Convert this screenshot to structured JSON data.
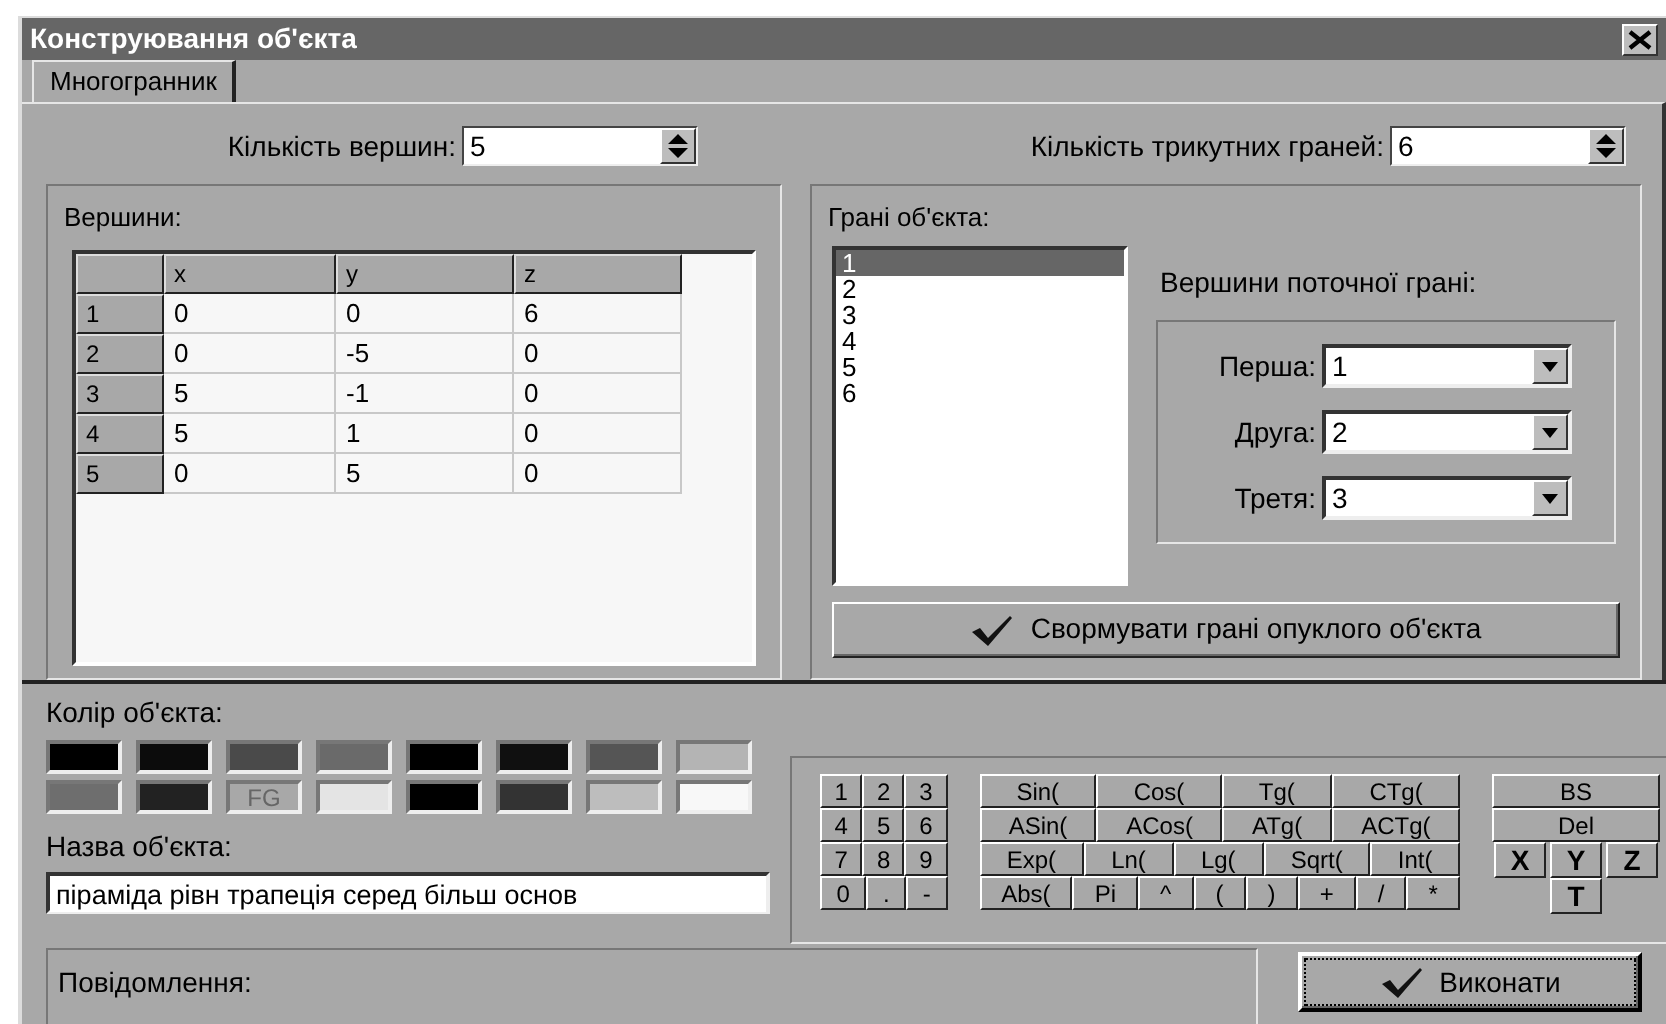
{
  "window": {
    "title": "Конструювання об'єкта"
  },
  "tabs": [
    {
      "label": "Многогранник",
      "selected": true
    }
  ],
  "vertex_count": {
    "label": "Кількість вершин:",
    "value": "5"
  },
  "face_count": {
    "label": "Кількість трикутних граней:",
    "value": "6"
  },
  "vertices": {
    "title": "Вершини:",
    "columns": [
      "x",
      "y",
      "z"
    ],
    "rows": [
      {
        "header": "1",
        "cells": [
          "0",
          "0",
          "6"
        ]
      },
      {
        "header": "2",
        "cells": [
          "0",
          "-5",
          "0"
        ]
      },
      {
        "header": "3",
        "cells": [
          "5",
          "-1",
          "0"
        ]
      },
      {
        "header": "4",
        "cells": [
          "5",
          "1",
          "0"
        ]
      },
      {
        "header": "5",
        "cells": [
          "0",
          "5",
          "0"
        ]
      }
    ]
  },
  "faces": {
    "title": "Грані об'єкта:",
    "items": [
      {
        "label": "1",
        "selected": true
      },
      {
        "label": "2",
        "selected": false
      },
      {
        "label": "3",
        "selected": false
      },
      {
        "label": "4",
        "selected": false
      },
      {
        "label": "5",
        "selected": false
      },
      {
        "label": "6",
        "selected": false
      }
    ]
  },
  "current_face": {
    "title": "Вершини поточної грані:",
    "fields": [
      {
        "label": "Перша:",
        "value": "1"
      },
      {
        "label": "Друга:",
        "value": "2"
      },
      {
        "label": "Третя:",
        "value": "3"
      }
    ]
  },
  "form_faces_button": "Свормувати грані опуклого об'єкта",
  "object_color": {
    "title": "Колір об'єкта:",
    "swatches": [
      {
        "color": "#000000"
      },
      {
        "color": "#0c0c0c"
      },
      {
        "color": "#4a4a4a"
      },
      {
        "color": "#6a6a6a"
      },
      {
        "color": "#000000"
      },
      {
        "color": "#101010"
      },
      {
        "color": "#555555"
      },
      {
        "color": "#b4b4b4"
      },
      {
        "color": "#6e6e6e"
      },
      {
        "color": "#222222"
      },
      {
        "color": "#a8a8a8",
        "label": "FG"
      },
      {
        "color": "#e4e4e4"
      },
      {
        "color": "#000000"
      },
      {
        "color": "#333333"
      },
      {
        "color": "#bdbdbd"
      },
      {
        "color": "#f8f8f8"
      }
    ]
  },
  "object_name": {
    "label": "Назва об'єкта:",
    "value": "піраміда рівн трапеція серед більш основ"
  },
  "keypad": {
    "digits": [
      [
        "1",
        "2",
        "3"
      ],
      [
        "4",
        "5",
        "6"
      ],
      [
        "7",
        "8",
        "9"
      ],
      [
        "0",
        ".",
        "-"
      ]
    ],
    "functions": [
      [
        "Sin(",
        "Cos(",
        "Tg(",
        "CTg("
      ],
      [
        "ASin(",
        "ACos(",
        "ATg(",
        "ACTg("
      ],
      [
        "Exp(",
        "Ln(",
        "Lg(",
        "Sqrt(",
        "Int("
      ],
      [
        "Abs(",
        "Pi",
        "^",
        "(",
        ")",
        "+",
        "/",
        "*"
      ]
    ],
    "edit_keys": [
      "BS",
      "Del"
    ],
    "variables": [
      [
        "X",
        "Y",
        "Z"
      ],
      [
        "T"
      ]
    ]
  },
  "message": {
    "label": "Повідомлення:"
  },
  "execute_button": "Виконати"
}
